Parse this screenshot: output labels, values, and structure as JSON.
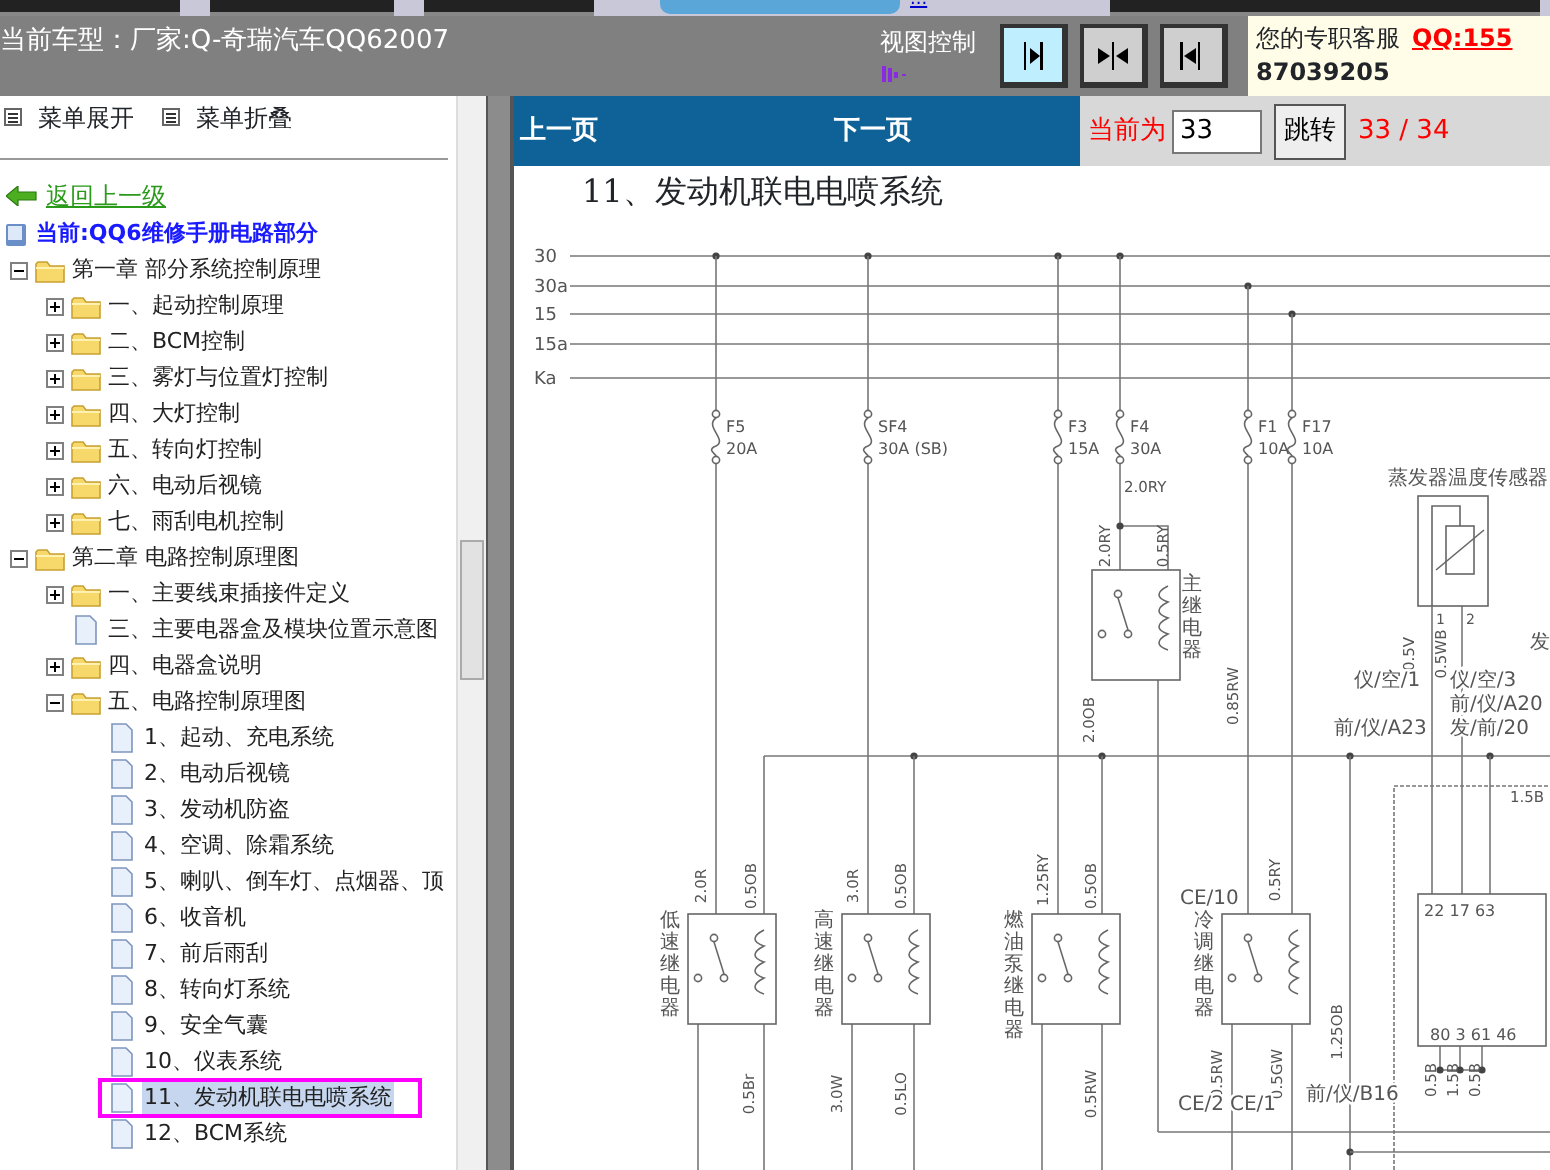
{
  "top_link": "...",
  "header": {
    "title": "当前车型：厂家:Q-奇瑞汽车QQ62007",
    "view_control_label": "视图控制",
    "service_label": "您的专职客服",
    "service_qq": "QQ:155",
    "service_phone": "87039205"
  },
  "menu_actions": [
    "菜单展开",
    "菜单折叠"
  ],
  "back_link": "返回上一级",
  "tree": {
    "root_label": "当前:QQ6维修手册电路部分",
    "nodes": [
      {
        "label": "第一章 部分系统控制原理",
        "kind": "folder",
        "expanded": true,
        "selected": false,
        "children": [
          {
            "label": "一、起动控制原理",
            "kind": "folder",
            "expanded": false,
            "selected": false
          },
          {
            "label": "二、BCM控制",
            "kind": "folder",
            "expanded": false,
            "selected": false
          },
          {
            "label": "三、雾灯与位置灯控制",
            "kind": "folder",
            "expanded": false,
            "selected": false
          },
          {
            "label": "四、大灯控制",
            "kind": "folder",
            "expanded": false,
            "selected": false
          },
          {
            "label": "五、转向灯控制",
            "kind": "folder",
            "expanded": false,
            "selected": false
          },
          {
            "label": "六、电动后视镜",
            "kind": "folder",
            "expanded": false,
            "selected": false
          },
          {
            "label": "七、雨刮电机控制",
            "kind": "folder",
            "expanded": false,
            "selected": false
          }
        ]
      },
      {
        "label": "第二章 电路控制原理图",
        "kind": "folder",
        "expanded": true,
        "selected": false,
        "children": [
          {
            "label": "一、主要线束插接件定义",
            "kind": "folder",
            "expanded": false,
            "selected": false
          },
          {
            "label": "三、主要电器盒及模块位置示意图",
            "kind": "doc",
            "selected": false
          },
          {
            "label": "四、电器盒说明",
            "kind": "folder",
            "expanded": false,
            "selected": false
          },
          {
            "label": "五、电路控制原理图",
            "kind": "folder",
            "expanded": true,
            "selected": false,
            "children": [
              {
                "label": "1、起动、充电系统",
                "kind": "doc",
                "selected": false
              },
              {
                "label": "2、电动后视镜",
                "kind": "doc",
                "selected": false
              },
              {
                "label": "3、发动机防盗",
                "kind": "doc",
                "selected": false
              },
              {
                "label": "4、空调、除霜系统",
                "kind": "doc",
                "selected": false
              },
              {
                "label": "5、喇叭、倒车灯、点烟器、顶",
                "kind": "doc",
                "selected": false
              },
              {
                "label": "6、收音机",
                "kind": "doc",
                "selected": false
              },
              {
                "label": "7、前后雨刮",
                "kind": "doc",
                "selected": false
              },
              {
                "label": "8、转向灯系统",
                "kind": "doc",
                "selected": false
              },
              {
                "label": "9、安全气囊",
                "kind": "doc",
                "selected": false
              },
              {
                "label": "10、仪表系统",
                "kind": "doc",
                "selected": false
              },
              {
                "label": "11、发动机联电电喷系统",
                "kind": "doc",
                "selected": true
              },
              {
                "label": "12、BCM系统",
                "kind": "doc",
                "selected": false
              }
            ]
          }
        ]
      }
    ]
  },
  "pager": {
    "prev": "上一页",
    "next": "下一页",
    "current_label": "当前为",
    "page_value": "33",
    "jump_button": "跳转",
    "page_count": "33 / 34"
  },
  "document": {
    "title": "11、发动机联电电喷系统",
    "diagram": {
      "bus_lines": [
        "30",
        "30a",
        "15",
        "15a",
        "Ka"
      ],
      "fuses": [
        {
          "name": "F5",
          "rating": "20A"
        },
        {
          "name": "SF4",
          "rating": "30A (SB)"
        },
        {
          "name": "F3",
          "rating": "15A"
        },
        {
          "name": "F4",
          "rating": "30A"
        },
        {
          "name": "F1",
          "rating": "10A"
        },
        {
          "name": "F17",
          "rating": "10A"
        }
      ],
      "relays": [
        "主继电器",
        "低速继电器",
        "高速继电器",
        "燃油泵继电器",
        "冷调继电器"
      ],
      "sensor_label": "蒸发器温度传感器",
      "sensor_pins": [
        "1",
        "2"
      ],
      "wire_labels": [
        "2.0RY",
        "2.0RY",
        "0.5RY",
        "0.5V",
        "0.5WB",
        "0.85RW",
        "2.0OB",
        "1.5B",
        "2.0R",
        "0.5OB",
        "3.0R",
        "0.5OB",
        "1.25RY",
        "0.5OB",
        "0.5RY",
        "0.5Br",
        "3.0W",
        "0.5LO",
        "0.5RW",
        "0.5RW",
        "0.5GW",
        "1.25OB",
        "0.5B",
        "1.5B",
        "0.5B"
      ],
      "connectors": [
        "仪/空/1",
        "仪/空/3",
        "前/仪/A20",
        "前/仪/A23",
        "发/前/20",
        "CE/10",
        "CE/2",
        "CE/1",
        "前/仪/B16"
      ],
      "ecu_pins_top": "22 17 63",
      "ecu_pins_bottom": "80 3 61 46",
      "cut_label": "发"
    }
  }
}
